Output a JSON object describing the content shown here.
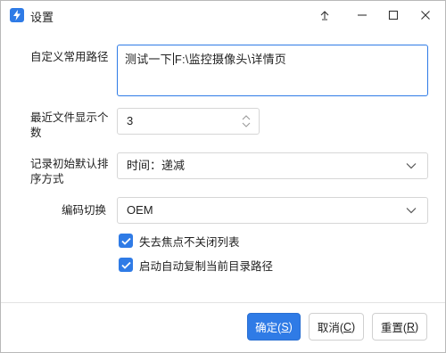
{
  "window": {
    "title": "设置",
    "accent_color": "#2f7be6",
    "controls": [
      "pin-icon",
      "minimize-icon",
      "maximize-icon",
      "close-icon"
    ]
  },
  "settings": {
    "common_path": {
      "label": "自定义常用路径",
      "value_before_caret": "测试一下",
      "value_after_caret": "F:\\监控摄像头\\详情页"
    },
    "recent_files": {
      "label": "最近文件显示个数",
      "value": "3"
    },
    "sort_order": {
      "label": "记录初始默认排序方式",
      "selected": "时间：递减"
    },
    "encoding": {
      "label": "编码切换",
      "selected": "OEM"
    },
    "options": [
      {
        "label": "失去焦点不关闭列表",
        "checked": true
      },
      {
        "label": "启动自动复制当前目录路径",
        "checked": true
      }
    ]
  },
  "buttons": {
    "ok": {
      "text": "确定(",
      "key": "S",
      "suffix": ")"
    },
    "cancel": {
      "text": "取消(",
      "key": "C",
      "suffix": ")"
    },
    "reset": {
      "text": "重置(",
      "key": "R",
      "suffix": ")"
    }
  }
}
